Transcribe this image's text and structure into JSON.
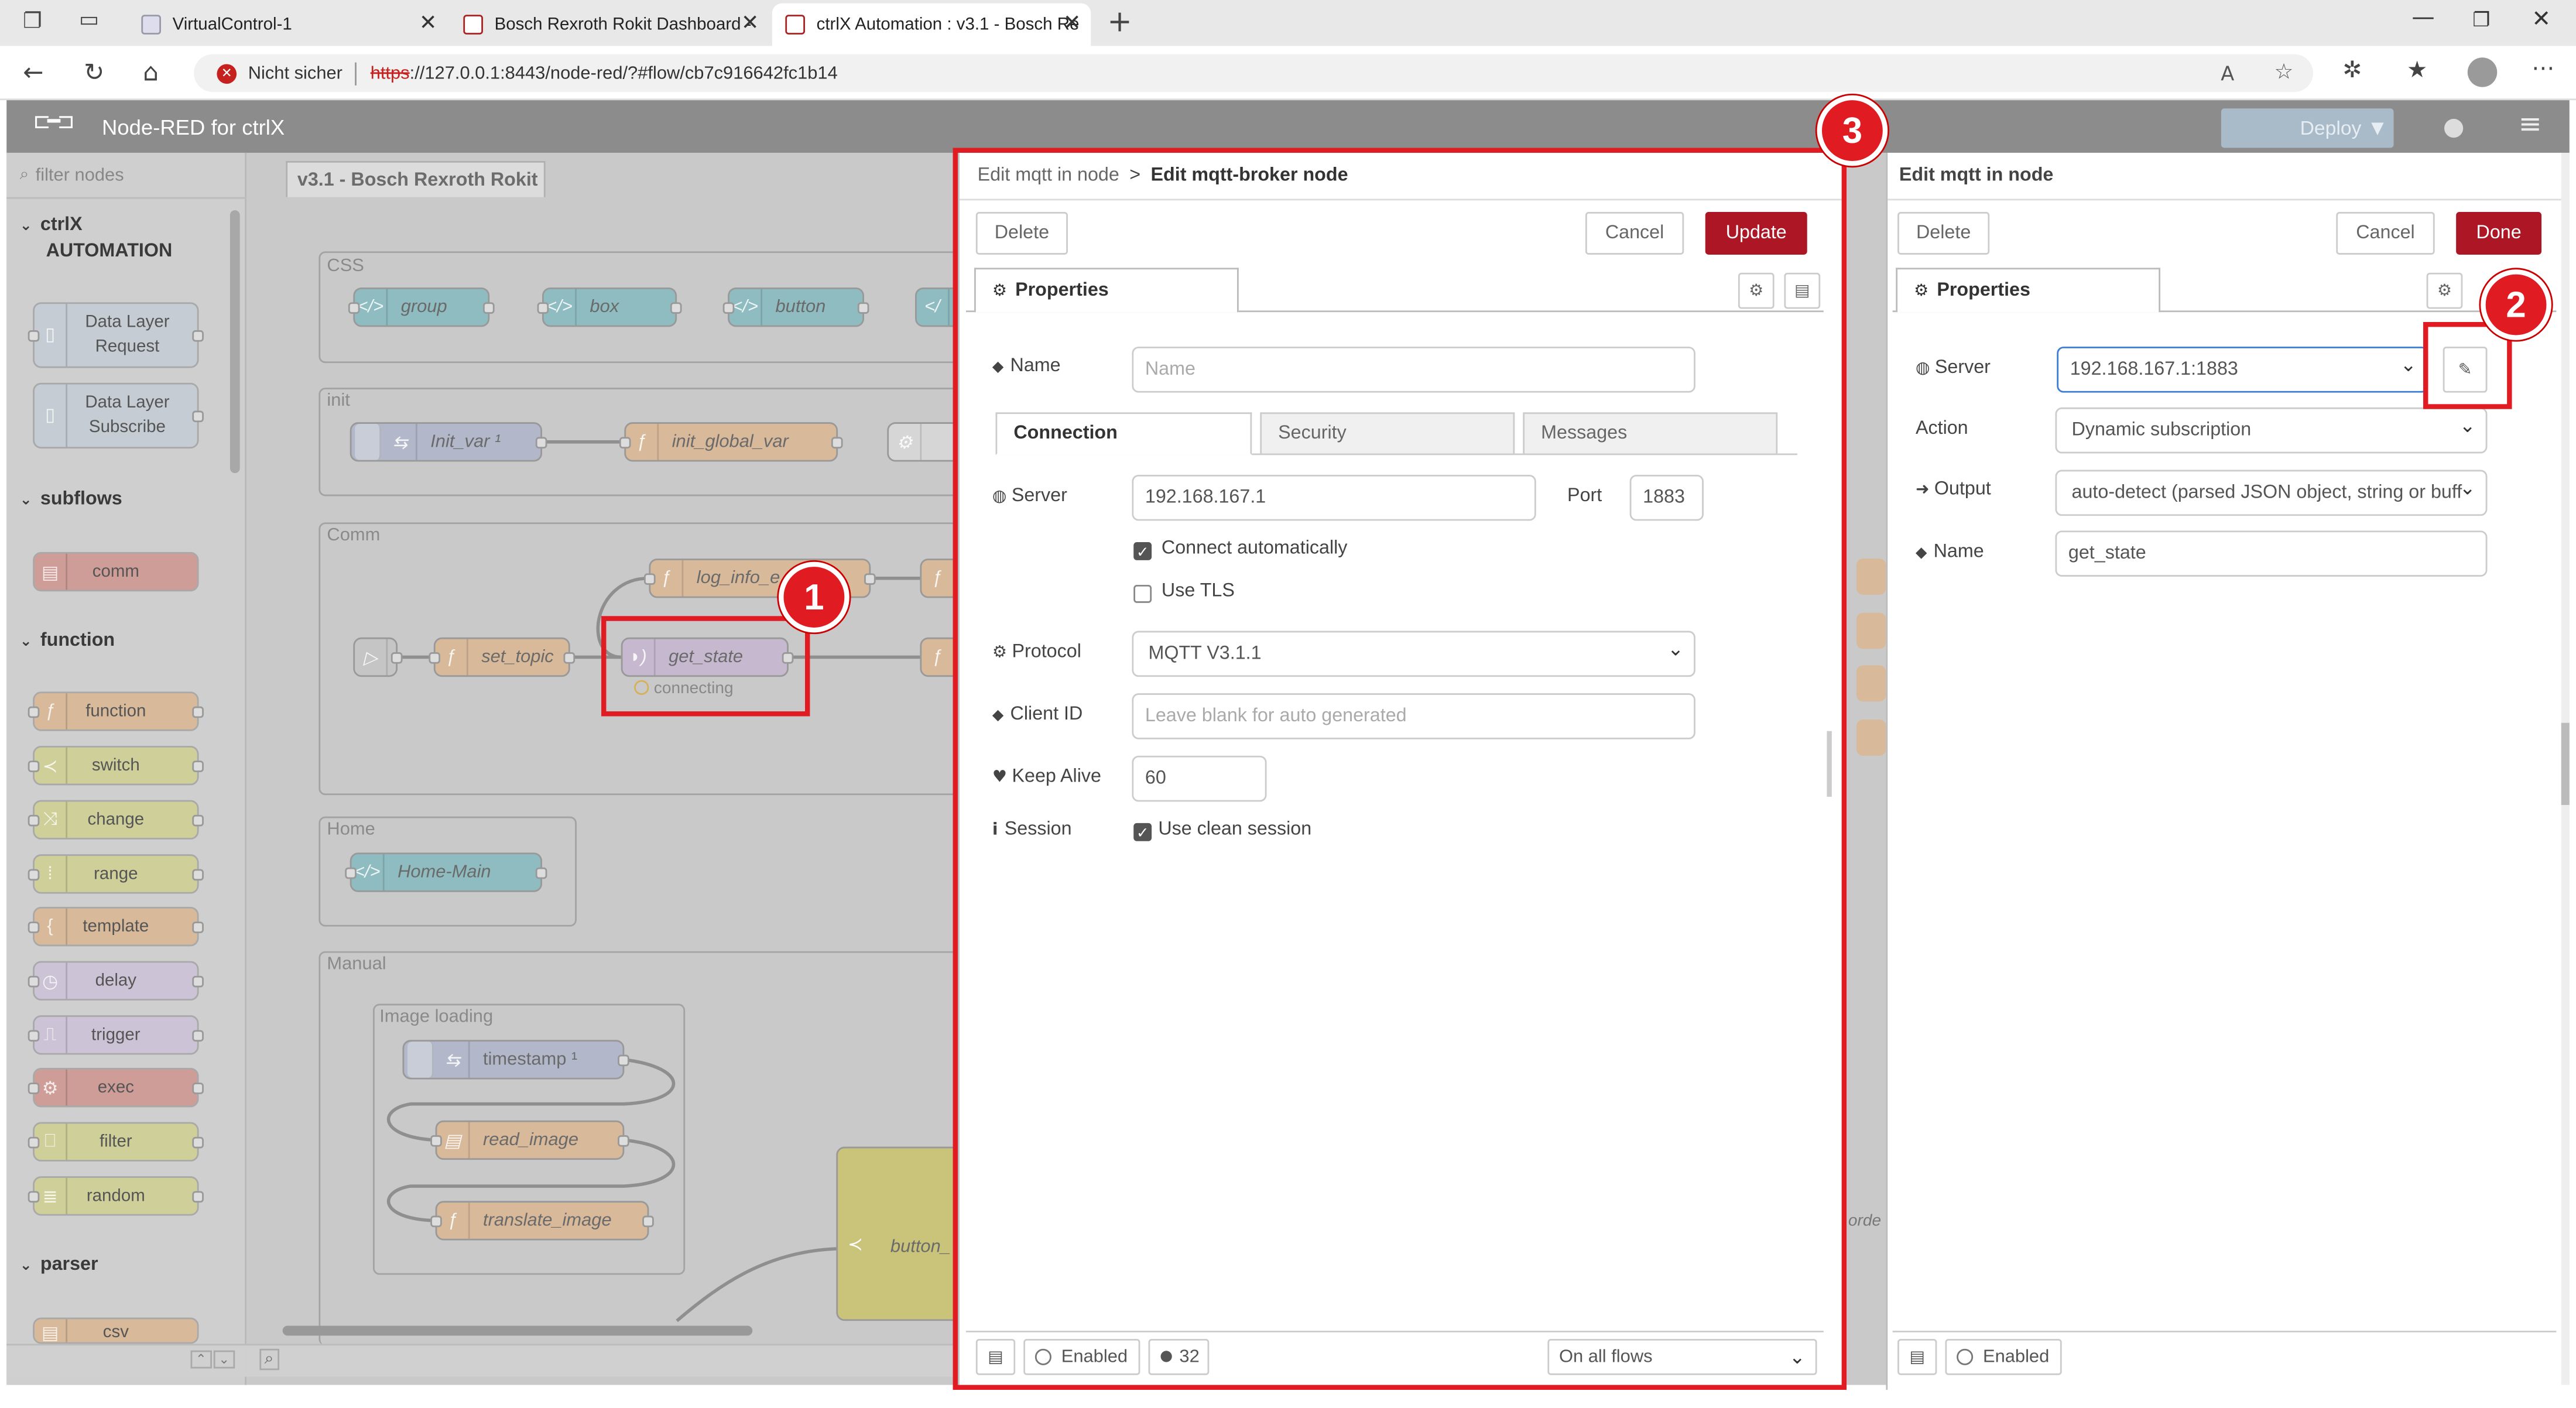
{
  "browser": {
    "tabs": [
      {
        "title": "VirtualControl-1"
      },
      {
        "title": "Bosch Rexroth Rokit Dashboard -"
      },
      {
        "title": "ctrlX Automation : v3.1 - Bosch Re"
      }
    ],
    "security_label": "Nicht sicher",
    "url_scheme": "https",
    "url_rest": "://127.0.0.1:8443/node-red/?#flow/cb7c916642fc1b14"
  },
  "app": {
    "title": "Node-RED for ctrlX",
    "deploy_label": "Deploy"
  },
  "palette": {
    "filter_placeholder": "filter nodes",
    "categories": {
      "ctrlx_line1": "ctrlX",
      "ctrlx_line2": "AUTOMATION",
      "subflows": "subflows",
      "function": "function",
      "parser": "parser"
    },
    "nodes": {
      "dl_request_1": "Data Layer",
      "dl_request_2": "Request",
      "dl_subscribe_1": "Data Layer",
      "dl_subscribe_2": "Subscribe",
      "comm": "comm",
      "function": "function",
      "switch": "switch",
      "change": "change",
      "range": "range",
      "template": "template",
      "delay": "delay",
      "trigger": "trigger",
      "exec": "exec",
      "filter": "filter",
      "random": "random",
      "csv": "csv"
    }
  },
  "workspace": {
    "tab_label": "v3.1 - Bosch Rexroth Rokit",
    "groups": {
      "css": "CSS",
      "init": "init",
      "comm": "Comm",
      "home": "Home",
      "manual": "Manual",
      "image_loading": "Image loading"
    },
    "nodes": {
      "group": "group",
      "box": "box",
      "button": "button",
      "init_var": "Init_var ¹",
      "init_global_var": "init_global_var",
      "log_info": "log_info_e",
      "set_topic": "set_topic",
      "get_state": "get_state",
      "get_state_status": "connecting",
      "home_main": "Home-Main",
      "timestamp": "timestamp ¹",
      "read_image": "read_image",
      "translate_image": "translate_image",
      "button_partial": "button_",
      "right_edge_text": "orde"
    }
  },
  "broker_editor": {
    "breadcrumb_parent": "Edit mqtt in node",
    "breadcrumb_sep": ">",
    "breadcrumb_current": "Edit mqtt-broker node",
    "delete_label": "Delete",
    "cancel_label": "Cancel",
    "update_label": "Update",
    "properties_tab": "Properties",
    "name_label": "Name",
    "name_placeholder": "Name",
    "tabs": [
      "Connection",
      "Security",
      "Messages"
    ],
    "server_label": "Server",
    "server_value": "192.168.167.1",
    "port_label": "Port",
    "port_value": "1883",
    "connect_auto_label": "Connect automatically",
    "connect_auto_checked": true,
    "use_tls_label": "Use TLS",
    "use_tls_checked": false,
    "protocol_label": "Protocol",
    "protocol_value": "MQTT V3.1.1",
    "client_id_label": "Client ID",
    "client_id_placeholder": "Leave blank for auto generated",
    "keep_alive_label": "Keep Alive",
    "keep_alive_value": "60",
    "session_label": "Session",
    "clean_session_label": "Use clean session",
    "clean_session_checked": true,
    "footer_enabled": "Enabled",
    "footer_users": "32",
    "footer_scope": "On all flows"
  },
  "mqtt_in_editor": {
    "title": "Edit mqtt in node",
    "delete_label": "Delete",
    "cancel_label": "Cancel",
    "done_label": "Done",
    "properties_tab": "Properties",
    "server_label": "Server",
    "server_value": "192.168.167.1:1883",
    "action_label": "Action",
    "action_value": "Dynamic subscription",
    "output_label": "Output",
    "output_value": "auto-detect (parsed JSON object, string or buff",
    "name_label": "Name",
    "name_value": "get_state",
    "footer_enabled": "Enabled"
  },
  "annotations": {
    "badge1": "1",
    "badge2": "2",
    "badge3": "3"
  },
  "colors": {
    "accent_red": "#ad1625",
    "callout_red": "#e11b22",
    "header_gray": "#8c8c8c"
  }
}
